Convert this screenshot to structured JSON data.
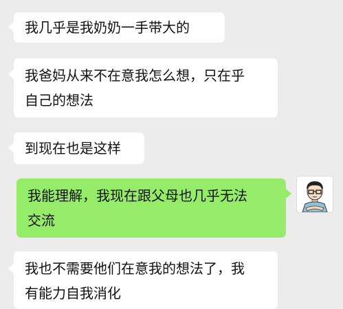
{
  "messages": [
    {
      "side": "in",
      "lines": [
        "我几乎是我奶奶一手带大的"
      ]
    },
    {
      "side": "in",
      "lines": [
        "我爸妈从来不在意我怎么想，只在乎",
        "自己的想法"
      ]
    },
    {
      "side": "in",
      "lines": [
        "到现在也是这样"
      ]
    },
    {
      "side": "out",
      "lines": [
        "我能理解，我现在跟父母也几乎无法",
        "交流"
      ]
    },
    {
      "side": "in",
      "lines": [
        "我也不需要他们在意我的想法了，我",
        "有能力自我消化"
      ]
    }
  ],
  "self_avatar": {
    "icon": "cartoon-man-with-glasses-avatar"
  },
  "colors": {
    "background": "#ececec",
    "incoming_bubble": "#ffffff",
    "outgoing_bubble": "#95ec69",
    "text": "#111111"
  }
}
